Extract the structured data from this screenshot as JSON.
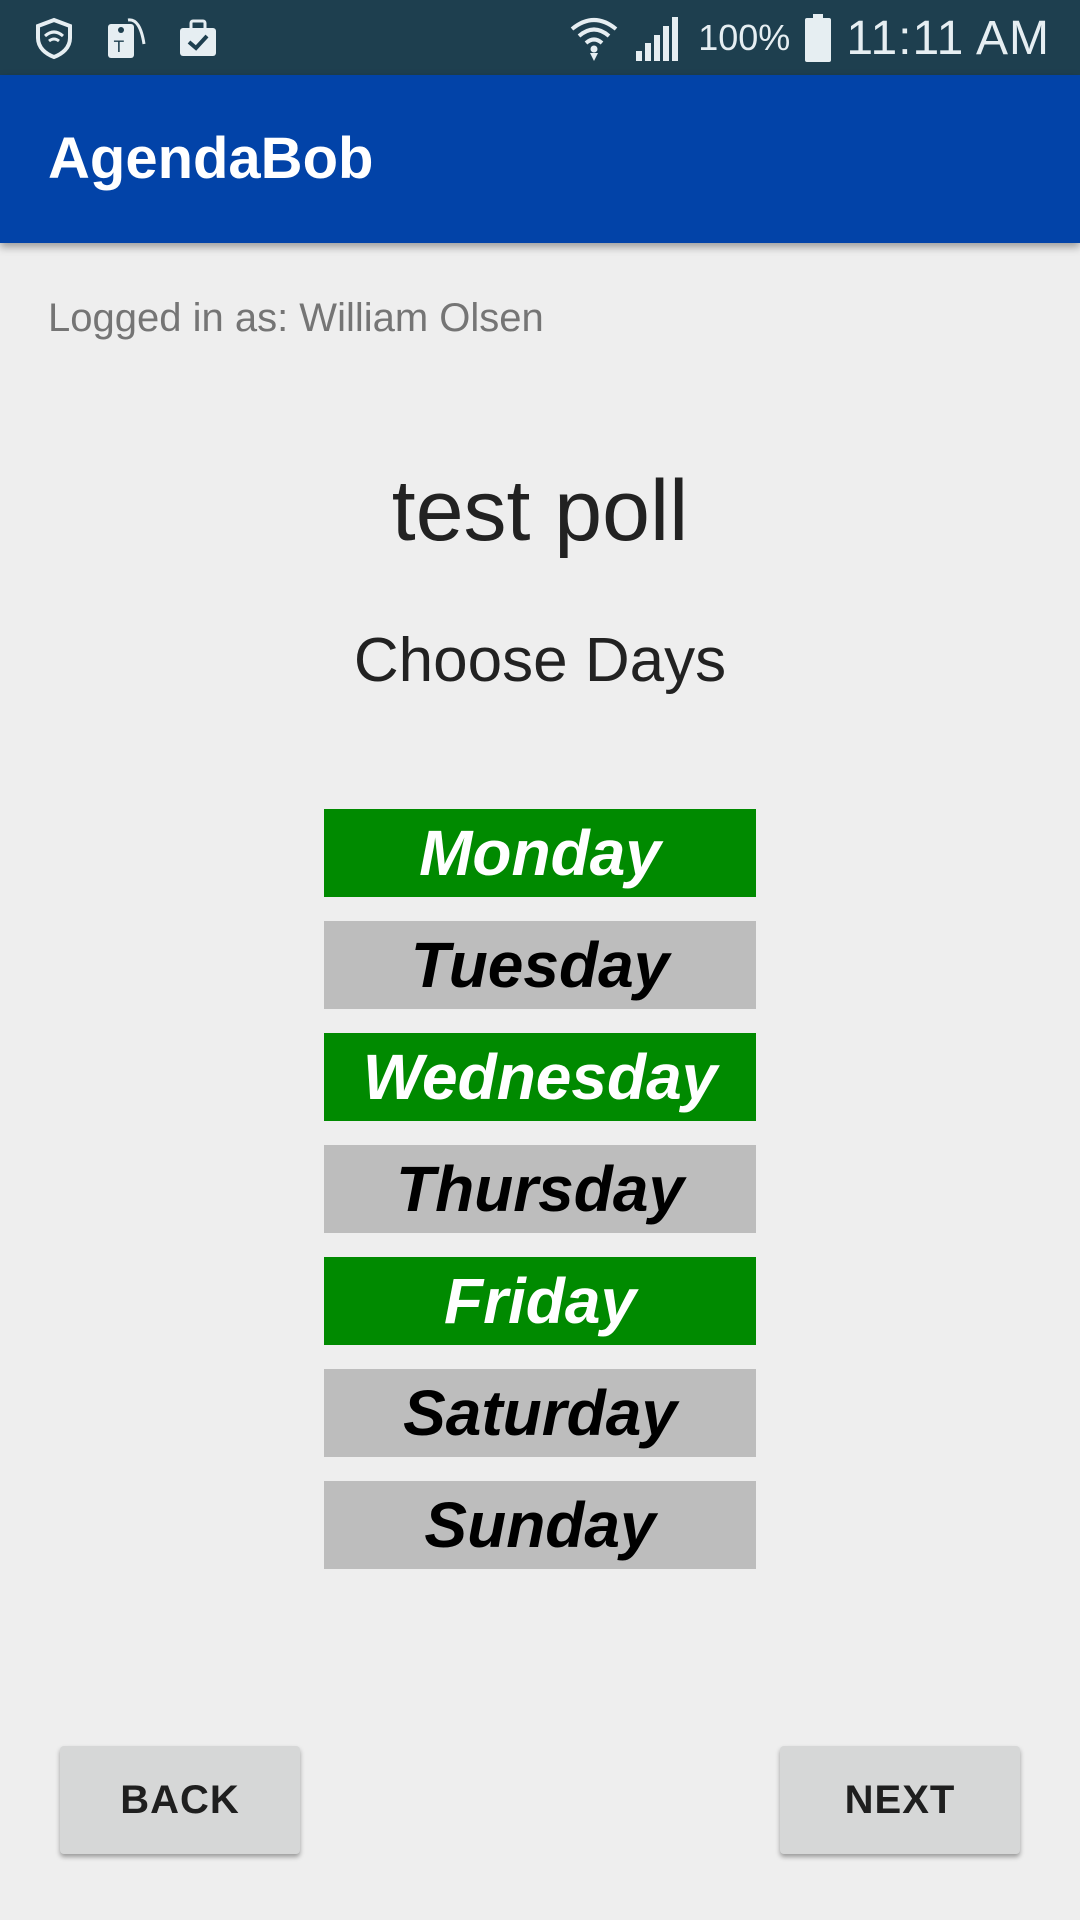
{
  "status_bar": {
    "icons_left": [
      "security-shield-icon",
      "tag-icon",
      "briefcase-check-icon"
    ],
    "icons_right": [
      "wifi-icon",
      "signal-icon",
      "battery-icon"
    ],
    "battery_percent": "100%",
    "time": "11:11 AM"
  },
  "app_bar": {
    "title": "AgendaBob"
  },
  "logged_in_text": "Logged in as: William Olsen",
  "poll_title": "test poll",
  "subtitle": "Choose Days",
  "days": [
    {
      "label": "Monday",
      "selected": true
    },
    {
      "label": "Tuesday",
      "selected": false
    },
    {
      "label": "Wednesday",
      "selected": true
    },
    {
      "label": "Thursday",
      "selected": false
    },
    {
      "label": "Friday",
      "selected": true
    },
    {
      "label": "Saturday",
      "selected": false
    },
    {
      "label": "Sunday",
      "selected": false
    }
  ],
  "buttons": {
    "back_label": "BACK",
    "next_label": "NEXT"
  },
  "colors": {
    "status_bar": "#1e3f4f",
    "app_bar": "#0243a8",
    "selected_day": "#008a00",
    "unselected_day": "#bdbdbd",
    "background": "#eeeeee"
  }
}
